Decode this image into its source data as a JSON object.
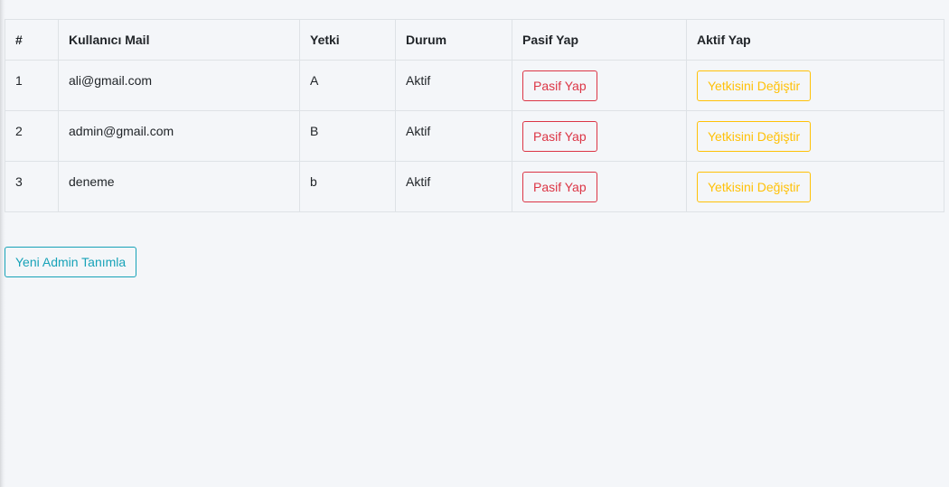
{
  "table": {
    "headers": [
      "#",
      "Kullanıcı Mail",
      "Yetki",
      "Durum",
      "Pasif Yap",
      "Aktif Yap"
    ],
    "rows": [
      {
        "no": "1",
        "mail": "ali@gmail.com",
        "yetki": "A",
        "durum": "Aktif",
        "pasif_btn": "Pasif Yap",
        "yetki_btn": "Yetkisini Değiştir"
      },
      {
        "no": "2",
        "mail": "admin@gmail.com",
        "yetki": "B",
        "durum": "Aktif",
        "pasif_btn": "Pasif Yap",
        "yetki_btn": "Yetkisini Değiştir"
      },
      {
        "no": "3",
        "mail": "deneme",
        "yetki": "b",
        "durum": "Aktif",
        "pasif_btn": "Pasif Yap",
        "yetki_btn": "Yetkisini Değiştir"
      }
    ]
  },
  "actions": {
    "new_admin_label": "Yeni Admin Tanımla"
  },
  "colors": {
    "danger": "#dc3545",
    "warning": "#ffc107",
    "info": "#17a2b8",
    "background": "#f4f6f9"
  }
}
